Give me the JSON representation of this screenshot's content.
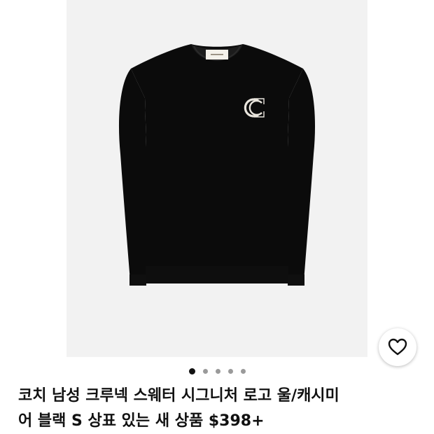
{
  "product": {
    "title_line1": "코치 남성 크루넥 스웨터 시그니처 로고 울/캐시미",
    "title_line2": "어 블랙 S 상표 있는 새 상품 $398+",
    "image_icon": "black-crewneck-sweater-with-c-logo",
    "wishlist_icon": "heart-outline-icon"
  },
  "carousel": {
    "dot_count": 5,
    "active_index": 0
  },
  "colors": {
    "sweater": "#0b0b0b",
    "background": "#f2f2f2",
    "active_dot": "#111111",
    "inactive_dot": "#9a9a9a"
  }
}
